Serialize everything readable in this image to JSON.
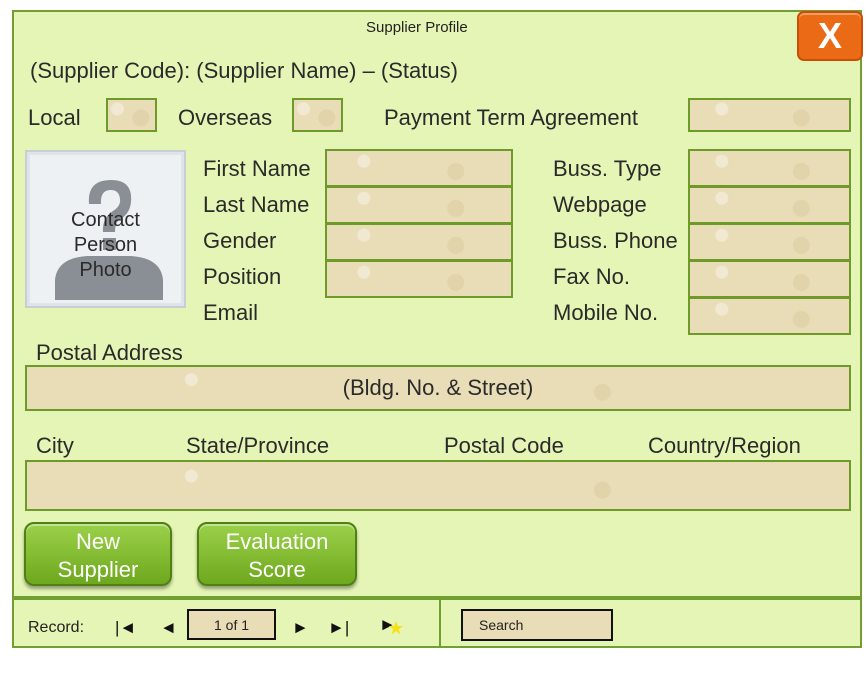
{
  "window": {
    "title": "Supplier Profile",
    "close_label": "X"
  },
  "header": {
    "line": "(Supplier Code): (Supplier Name) – (Status)"
  },
  "row1": {
    "local": "Local",
    "overseas": "Overseas",
    "payment_term": "Payment Term Agreement"
  },
  "photo": {
    "label_line1": "Contact",
    "label_line2": "Person",
    "label_line3": "Photo"
  },
  "contact": {
    "first_name": "First Name",
    "last_name": "Last Name",
    "gender": "Gender",
    "position": "Position",
    "email": "Email"
  },
  "business": {
    "type": "Buss. Type",
    "webpage": "Webpage",
    "phone": "Buss. Phone",
    "fax": "Fax No.",
    "mobile": "Mobile No."
  },
  "address": {
    "label": "Postal Address",
    "street_placeholder": "(Bldg. No. & Street)",
    "city": "City",
    "state": "State/Province",
    "postal_code": "Postal Code",
    "country": "Country/Region"
  },
  "buttons": {
    "new_line1": "New",
    "new_line2": "Supplier",
    "eval_line1": "Evaluation",
    "eval_line2": "Score"
  },
  "navigation": {
    "record_label": "Record:",
    "first": "|◄",
    "prev": "◄",
    "position": "1 of 1",
    "next": "►",
    "last": "►|",
    "new": "►",
    "search": "Search"
  },
  "colors": {
    "form_bg": "#e4f5b5",
    "field_bg": "#e9ddb8",
    "accent": "#72a030",
    "close": "#ea6a16"
  }
}
